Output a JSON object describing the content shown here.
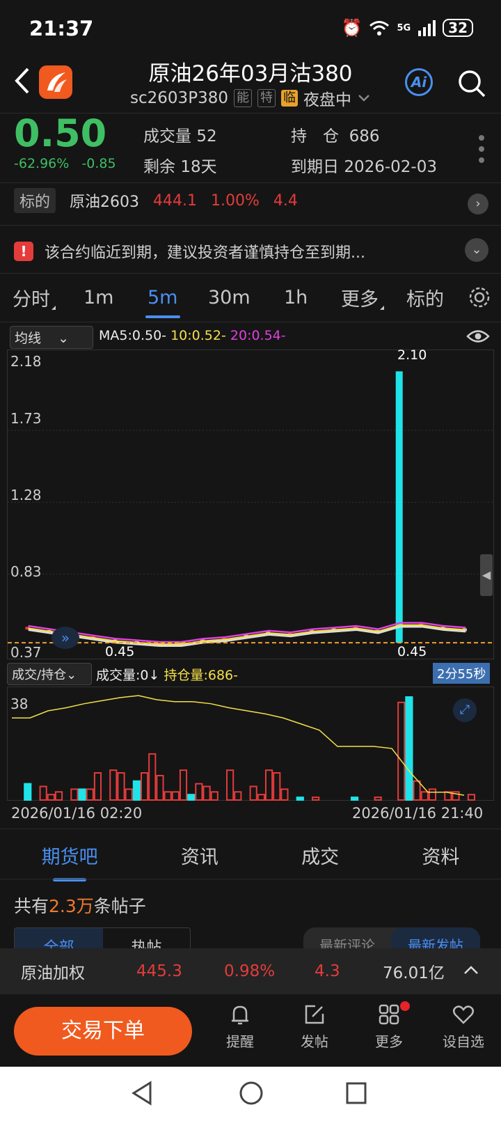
{
  "status": {
    "time": "21:37",
    "battery": "32",
    "network": "5G"
  },
  "header": {
    "title": "原油26年03月沽380",
    "code": "sc2603P380",
    "tags": [
      "能",
      "特"
    ],
    "tag_highlight": "临",
    "session": "夜盘中"
  },
  "quote": {
    "price": "0.50",
    "change_pct": "-62.96%",
    "change": "-0.85",
    "volume_label": "成交量",
    "volume": "52",
    "open_interest_label": "持　仓",
    "open_interest": "686",
    "remaining_label": "剩余",
    "remaining": "18天",
    "expiry_label": "到期日",
    "expiry": "2026-02-03"
  },
  "underlying": {
    "tag": "标的",
    "name": "原油2603",
    "price": "444.1",
    "pct": "1.00%",
    "change": "4.4"
  },
  "notice": {
    "text": "该合约临近到期，建议投资者谨慎持仓至到期..."
  },
  "period_tabs": [
    {
      "label": "分时"
    },
    {
      "label": "1m"
    },
    {
      "label": "5m"
    },
    {
      "label": "30m"
    },
    {
      "label": "1h"
    },
    {
      "label": "更多"
    },
    {
      "label": "标的"
    }
  ],
  "main_chart": {
    "selector": "均线",
    "ma5": "MA5:0.50-",
    "ma10": "10:0.52-",
    "ma20": "20:0.54-",
    "y_labels": [
      "2.18",
      "1.73",
      "1.28",
      "0.83",
      "0.37"
    ],
    "peak_label": "2.10",
    "low_label_1": "0.45",
    "low_label_2": "0.45"
  },
  "sub_chart": {
    "selector": "成交/持仓",
    "volume_legend": "成交量:0↓",
    "oi_legend": "持仓量:686-",
    "countdown": "2分55秒",
    "y_label": "38",
    "start_time": "2026/01/16 02:20",
    "end_time": "2026/01/16 21:40"
  },
  "chart_data": [
    {
      "type": "bar",
      "title": "",
      "series": [
        {
          "name": "candles (approx high)",
          "values": [
            0.5,
            0.48,
            0.46,
            0.44,
            0.42,
            0.41,
            0.4,
            0.4,
            0.42,
            0.43,
            0.45,
            0.47,
            0.46,
            0.48,
            0.49,
            0.5,
            0.48,
            2.1,
            0.52,
            0.5,
            0.49
          ]
        }
      ],
      "ylim": [
        0.37,
        2.18
      ]
    },
    {
      "type": "bar",
      "title": "",
      "series": [
        {
          "name": "成交量",
          "values": [
            0,
            6,
            0,
            5,
            2,
            3,
            0,
            4,
            4,
            4,
            10,
            0,
            11,
            10,
            4,
            7,
            10,
            17,
            9,
            3,
            3,
            11,
            2,
            6,
            5,
            3,
            0,
            11,
            3,
            0,
            5,
            2,
            11,
            10,
            4,
            0,
            1,
            0,
            1,
            0,
            0,
            0,
            0,
            1,
            0,
            0,
            1,
            0,
            0,
            36,
            38,
            7,
            3,
            4,
            0,
            3,
            3,
            0,
            2
          ]
        }
      ],
      "ylim": [
        0,
        38
      ]
    }
  ],
  "bottom_tabs": [
    {
      "label": "期货吧"
    },
    {
      "label": "资讯"
    },
    {
      "label": "成交"
    },
    {
      "label": "资料"
    }
  ],
  "forum": {
    "count_prefix": "共有",
    "count": "2.3万",
    "count_suffix": "条帖子",
    "filter_all": "全部",
    "filter_hot": "热帖",
    "sort_reply": "最新评论",
    "sort_post": "最新发帖"
  },
  "ticker": {
    "name": "原油加权",
    "price": "445.3",
    "pct": "0.98%",
    "change": "4.3",
    "amount": "76.01亿"
  },
  "actions": {
    "trade": "交易下单",
    "remind": "提醒",
    "post": "发帖",
    "more": "更多",
    "watch": "设自选"
  },
  "colors": {
    "up": "#e43b3b",
    "down": "#3fbf63",
    "accent": "#4a8ff0",
    "brand": "#f05a1e",
    "cyan": "#1fe3e8"
  }
}
